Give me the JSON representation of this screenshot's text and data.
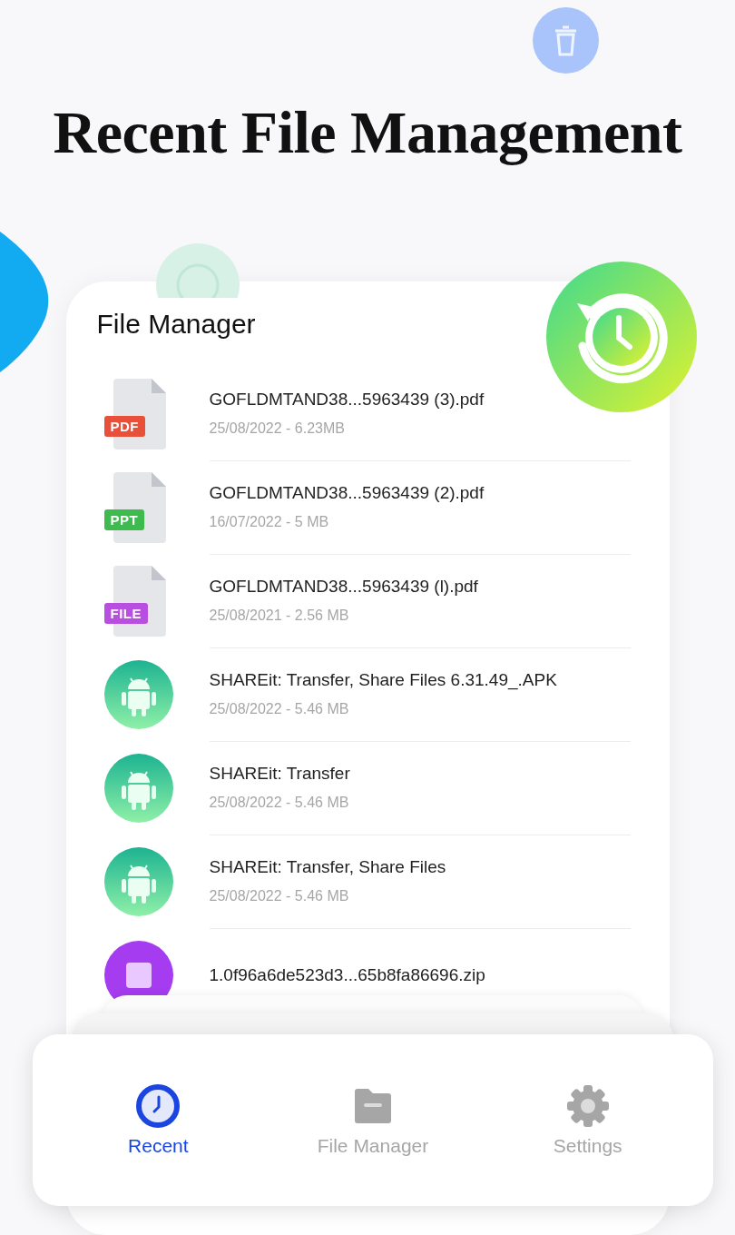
{
  "headline": "Recent File Management",
  "app": {
    "title": "File Manager",
    "files": [
      {
        "kind": "doc",
        "tag": "PDF",
        "color": "#e8503a",
        "name": "GOFLDMTAND38...5963439 (3).pdf",
        "meta": "25/08/2022 - 6.23MB"
      },
      {
        "kind": "doc",
        "tag": "PPT",
        "color": "#3dbb4f",
        "name": "GOFLDMTAND38...5963439 (2).pdf",
        "meta": "16/07/2022 - 5 MB"
      },
      {
        "kind": "doc",
        "tag": "FILE",
        "color": "#b84fe0",
        "name": "GOFLDMTAND38...5963439 (l).pdf",
        "meta": "25/08/2021 - 2.56 MB"
      },
      {
        "kind": "apk",
        "name": "SHAREit: Transfer, Share Files 6.31.49_.APK",
        "meta": "25/08/2022 - 5.46 MB"
      },
      {
        "kind": "apk",
        "name": "SHAREit: Transfer",
        "meta": "25/08/2022 - 5.46 MB"
      },
      {
        "kind": "apk",
        "name": "SHAREit: Transfer, Share Files",
        "meta": "25/08/2022 - 5.46 MB"
      },
      {
        "kind": "zip",
        "name": "1.0f96a6de523d3...65b8fa86696.zip"
      }
    ]
  },
  "nav": [
    {
      "label": "Recent",
      "selected": true
    },
    {
      "label": "File Manager",
      "selected": false
    },
    {
      "label": "Settings",
      "selected": false
    }
  ]
}
